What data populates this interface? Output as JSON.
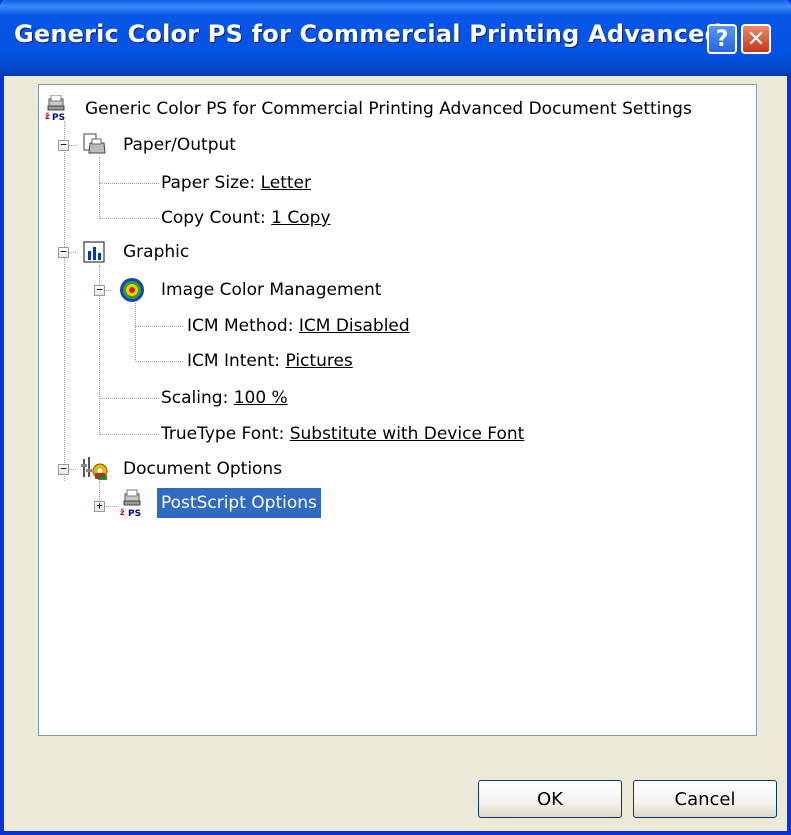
{
  "window": {
    "title": "Generic Color PS for Commercial Printing Advanced ...",
    "help_glyph": "?",
    "close_glyph": "✕"
  },
  "tree": {
    "root_label": "Generic Color PS for Commercial Printing Advanced Document Settings",
    "paper_output": {
      "label": "Paper/Output",
      "paper_size_label": "Paper Size: ",
      "paper_size_value": "Letter",
      "copy_count_label": "Copy Count: ",
      "copy_count_value": "1 Copy"
    },
    "graphic": {
      "label": "Graphic",
      "icm": {
        "label": "Image Color Management",
        "method_label": "ICM Method: ",
        "method_value": "ICM Disabled",
        "intent_label": "ICM Intent: ",
        "intent_value": "Pictures"
      },
      "scaling_label": "Scaling: ",
      "scaling_value": "100 %",
      "truetype_label": "TrueType Font: ",
      "truetype_value": "Substitute with Device Font"
    },
    "document_options": {
      "label": "Document Options",
      "postscript_label": "PostScript Options"
    },
    "expand_minus": "−",
    "expand_plus": "+"
  },
  "buttons": {
    "ok": "OK",
    "cancel": "Cancel"
  },
  "icons": {
    "root": "printer-ps-icon",
    "paper": "paper-output-icon",
    "graphic": "graphic-chart-icon",
    "icm": "color-target-icon",
    "docopts": "document-options-icon",
    "postscript": "printer-ps-icon"
  },
  "colors": {
    "titlebar": "#0453e3",
    "selection": "#316ac5",
    "dialog_bg": "#ece9d8"
  }
}
